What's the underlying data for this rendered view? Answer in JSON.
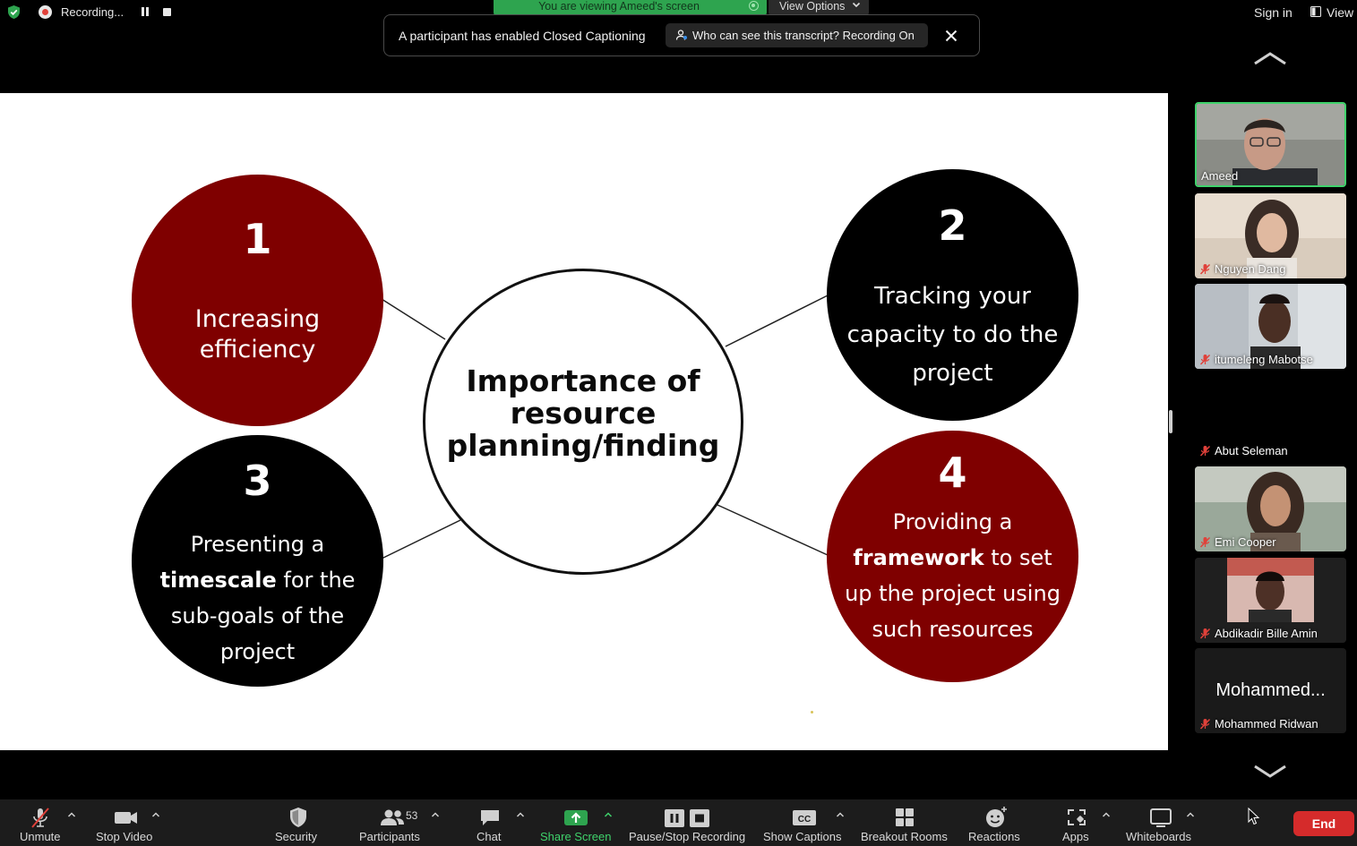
{
  "top_bar": {
    "recording_label": "Recording...",
    "viewing_banner": "You are viewing Ameed's screen",
    "view_options_label": "View Options",
    "sign_in_label": "Sign in",
    "view_label": "View"
  },
  "notification": {
    "message": "A participant has enabled Closed Captioning",
    "transcript_button": "Who can see this transcript? Recording On"
  },
  "slide": {
    "center_title": "Importance of resource planning/finding",
    "items": [
      {
        "number": "1",
        "text": "Increasing efficiency"
      },
      {
        "number": "2",
        "text": "Tracking your capacity to do the project"
      },
      {
        "number": "3",
        "text_before": "Presenting a",
        "text_bold": "timescale",
        "text_after": "for the sub-goals of the project"
      },
      {
        "number": "4",
        "text_before": "Providing a",
        "text_bold": "framework",
        "text_after": "to set up the project using such resources"
      }
    ],
    "colors": {
      "red": "#7f0000",
      "black": "#000000"
    }
  },
  "participants": [
    {
      "name": "Ameed",
      "active": true,
      "muted": false
    },
    {
      "name": "Nguyen Dang",
      "muted": true
    },
    {
      "name": "itumeleng Mabotse",
      "muted": true
    },
    {
      "name": "Abut Seleman",
      "muted": true
    },
    {
      "name": "Emi Cooper",
      "muted": true
    },
    {
      "name": "Abdikadir Bille Amin",
      "muted": true
    },
    {
      "name": "Mohammed Ridwan",
      "display": "Mohammed...",
      "muted": true
    }
  ],
  "toolbar": {
    "unmute": "Unmute",
    "stop_video": "Stop Video",
    "security": "Security",
    "participants": "Participants",
    "participants_count": "53",
    "chat": "Chat",
    "share_screen": "Share Screen",
    "pause_stop_recording": "Pause/Stop Recording",
    "show_captions": "Show Captions",
    "breakout_rooms": "Breakout Rooms",
    "reactions": "Reactions",
    "apps": "Apps",
    "whiteboards": "Whiteboards",
    "end": "End",
    "accent_green": "#2ea44f",
    "end_red": "#d52b2b"
  }
}
